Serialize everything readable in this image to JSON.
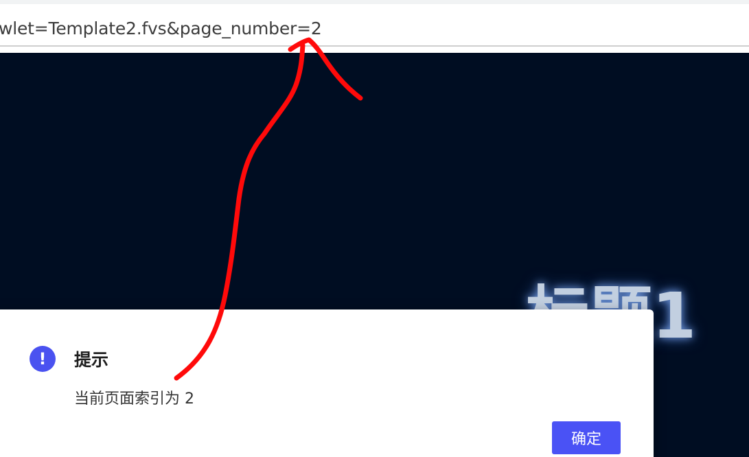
{
  "browser": {
    "url_visible": "wlet=Template2.fvs&page_number=2"
  },
  "report": {
    "title": "标题1"
  },
  "dialog": {
    "icon": "exclamation-circle-icon",
    "title": "提示",
    "message": "当前页面索引为 2",
    "confirm_label": "确定"
  },
  "colors": {
    "report_background": "#000d22",
    "dialog_accent": "#4a52f5",
    "annotation": "#ff0a0a"
  }
}
